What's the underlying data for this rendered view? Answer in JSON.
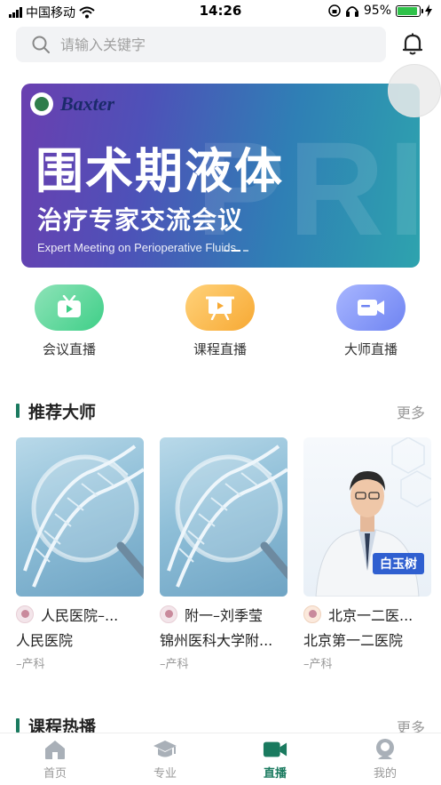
{
  "status_bar": {
    "carrier": "中国移动",
    "time": "14:26",
    "battery": "95%",
    "battery_level": 0.95
  },
  "search": {
    "placeholder": "请输入关键字"
  },
  "banner": {
    "brand": "Baxter",
    "title": "围术期液体",
    "subtitle": "治疗专家交流会议",
    "english": "Expert Meeting on Perioperative Fluids",
    "bg_letters": "PRI"
  },
  "categories": [
    {
      "label": "会议直播",
      "icon": "tv-play-icon",
      "color": "#3fcf88"
    },
    {
      "label": "课程直播",
      "icon": "board-play-icon",
      "color": "#f7a934"
    },
    {
      "label": "大师直播",
      "icon": "video-camera-icon",
      "color": "#6f84f2"
    }
  ],
  "recommended": {
    "title": "推荐大师",
    "more": "更多",
    "cards": [
      {
        "name": "人民医院–...",
        "hospital": "人民医院",
        "dept": "–产科"
      },
      {
        "name": "附一–刘季莹",
        "hospital": "锦州医科大学附...",
        "dept": "–产科"
      },
      {
        "name": "北京一二医...",
        "hospital": "北京第一二医院",
        "dept": "–产科",
        "photo_tag": "白玉树"
      }
    ]
  },
  "courses": {
    "title": "课程热播",
    "more": "更多"
  },
  "tabbar": {
    "items": [
      {
        "label": "首页",
        "icon": "home-icon"
      },
      {
        "label": "专业",
        "icon": "graduation-cap-icon"
      },
      {
        "label": "直播",
        "icon": "live-camera-icon",
        "active": true
      },
      {
        "label": "我的",
        "icon": "user-icon"
      }
    ],
    "active_color": "#1a7a5f"
  }
}
